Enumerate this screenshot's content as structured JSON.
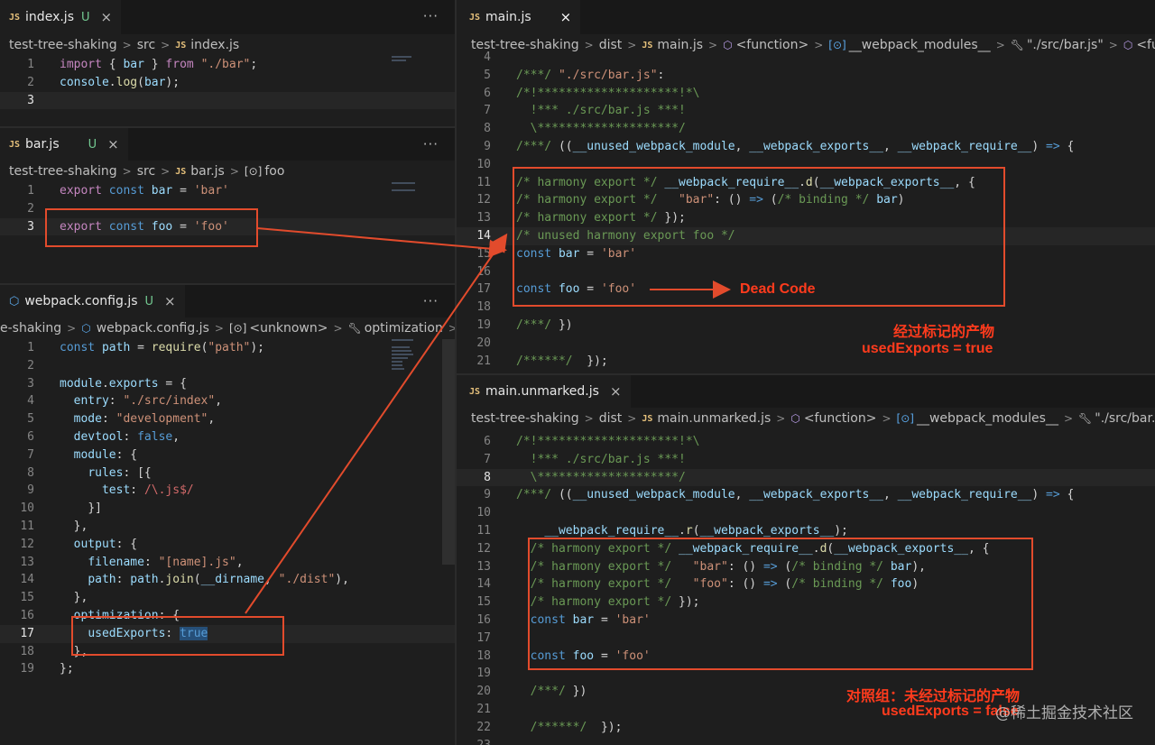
{
  "index_pane": {
    "tab_label": "index.js",
    "tab_badge": "JS",
    "tab_status": "U",
    "crumbs": [
      "test-tree-shaking",
      "src",
      "index.js"
    ],
    "lines": [
      {
        "n": "1"
      },
      {
        "n": "2"
      },
      {
        "n": "3"
      }
    ]
  },
  "bar_pane": {
    "tab_label": "bar.js",
    "tab_badge": "JS",
    "tab_status": "U",
    "crumbs": [
      "test-tree-shaking",
      "src",
      "bar.js",
      "foo"
    ],
    "lines": [
      {
        "n": "1"
      },
      {
        "n": "2"
      },
      {
        "n": "3"
      }
    ]
  },
  "config_pane": {
    "tab_label": "webpack.config.js",
    "tab_status": "U",
    "crumbs": [
      "e-shaking",
      "webpack.config.js",
      "<unknown>",
      "optimization"
    ],
    "lines": [
      "1",
      "2",
      "3",
      "4",
      "5",
      "6",
      "7",
      "8",
      "9",
      "10",
      "11",
      "12",
      "13",
      "14",
      "15",
      "16",
      "17",
      "18",
      "19"
    ]
  },
  "main_pane": {
    "tab_label": "main.js",
    "tab_badge": "JS",
    "crumbs": [
      "test-tree-shaking",
      "dist",
      "main.js",
      "<function>",
      "__webpack_modules__",
      "\"./src/bar.js\"",
      "<funct"
    ],
    "lines": [
      "4",
      "5",
      "6",
      "7",
      "8",
      "9",
      "10",
      "11",
      "12",
      "13",
      "14",
      "15",
      "16",
      "17",
      "18",
      "19",
      "20",
      "21"
    ]
  },
  "unmarked_pane": {
    "tab_label": "main.unmarked.js",
    "tab_badge": "JS",
    "crumbs": [
      "test-tree-shaking",
      "dist",
      "main.unmarked.js",
      "<function>",
      "__webpack_modules__",
      "\"./src/bar.js\""
    ],
    "lines": [
      "6",
      "7",
      "8",
      "9",
      "10",
      "11",
      "12",
      "13",
      "14",
      "15",
      "16",
      "17",
      "18",
      "19",
      "20",
      "21",
      "22",
      "23"
    ]
  },
  "annotations": {
    "dead_code": "Dead Code",
    "marked_title": "经过标记的产物",
    "marked_flag": "usedExports = true",
    "control_title": "对照组：未经过标记的产物",
    "control_flag": "usedExports = false"
  },
  "watermark": "@稀土掘金技术社区",
  "more_label": "···",
  "close_label": "×",
  "colors": {
    "accent_red": "#e24b2c",
    "bg": "#1e1e1e"
  }
}
